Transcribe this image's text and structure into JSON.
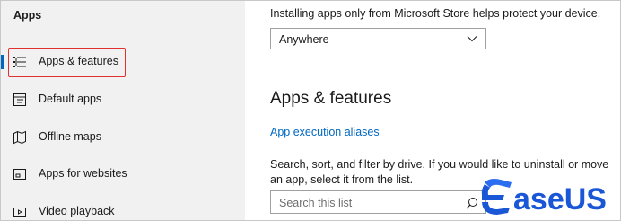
{
  "sidebar": {
    "title": "Apps",
    "items": [
      {
        "label": "Apps & features",
        "icon": "list-icon"
      },
      {
        "label": "Default apps",
        "icon": "default-apps-icon"
      },
      {
        "label": "Offline maps",
        "icon": "map-icon"
      },
      {
        "label": "Apps for websites",
        "icon": "web-apps-icon"
      },
      {
        "label": "Video playback",
        "icon": "video-icon"
      }
    ],
    "active_index": 0
  },
  "main": {
    "install_description": "Installing apps only from Microsoft Store helps protect your device.",
    "install_source": {
      "selected": "Anywhere"
    },
    "section_title": "Apps & features",
    "aliases_link": "App execution aliases",
    "search_description": "Search, sort, and filter by drive. If you would like to uninstall or move an app, select it from the list.",
    "search": {
      "placeholder": "Search this list"
    }
  },
  "watermark": {
    "text": "EaseUS"
  },
  "colors": {
    "accent": "#0067c0",
    "highlight": "#e0302f",
    "sidebar_bg": "#f1f1f1",
    "logo_blue": "#1a57d6"
  }
}
